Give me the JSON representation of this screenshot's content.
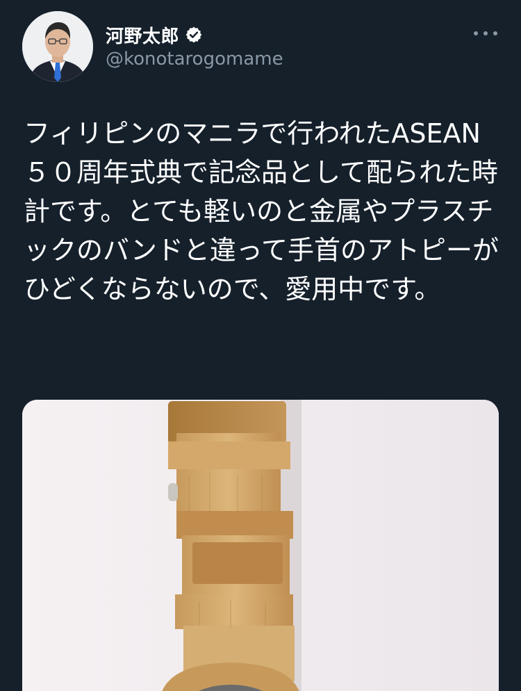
{
  "tweet": {
    "author": {
      "display_name": "河野太郎",
      "handle": "@konotarogomame",
      "verified": true,
      "avatar_icon": "avatar-photo"
    },
    "more_icon": "more-horizontal-icon",
    "text": "フィリピンのマニラで行われたASEAN５０周年式典で記念品として配られた時計です。とても軽いのと金属やプラスチックのバンドと違って手首のアトピーがひどくならないので、愛用中です。",
    "media": {
      "description_icon": "wooden-watch-photo"
    }
  },
  "colors": {
    "background": "#15202b",
    "text_primary": "#ffffff",
    "text_secondary": "#8b98a5"
  }
}
